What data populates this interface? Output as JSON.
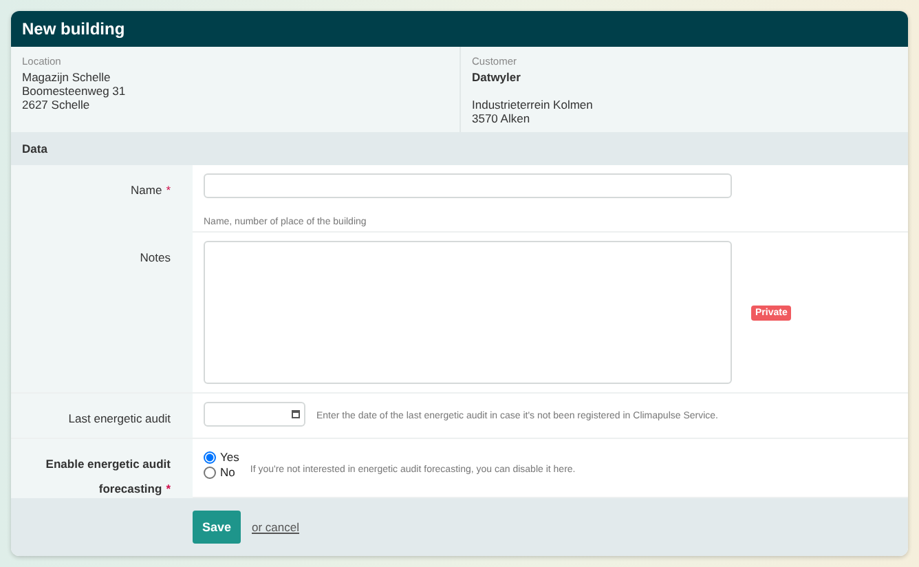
{
  "window": {
    "title": "New building"
  },
  "location": {
    "label": "Location",
    "lines": [
      "Magazijn Schelle",
      "Boomesteenweg 31",
      "2627 Schelle"
    ]
  },
  "customer": {
    "label": "Customer",
    "name": "Datwyler",
    "lines": [
      "Industrieterrein Kolmen",
      "3570 Alken"
    ]
  },
  "section": {
    "title": "Data"
  },
  "fields": [
    {
      "kind": "text",
      "label": "Name",
      "required_mark": "*",
      "help": "Name, number of place of the building"
    },
    {
      "kind": "textarea",
      "label": "Notes",
      "badge": "Private"
    },
    {
      "kind": "date",
      "label": "Last energetic audit",
      "help": "Enter the date of the last energetic audit in case it's not been registered in Climapulse Service."
    },
    {
      "kind": "radio",
      "label": "Enable energetic audit forecasting",
      "required_mark": "*",
      "options": [
        {
          "label": "Yes",
          "selected": true
        },
        {
          "label": "No",
          "selected": false
        }
      ],
      "help": "If you're not interested in energetic audit forecasting, you can disable it here."
    }
  ],
  "actions": {
    "save": "Save",
    "cancel": "or cancel"
  }
}
